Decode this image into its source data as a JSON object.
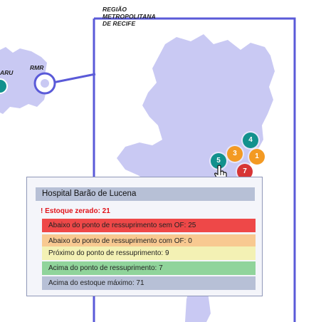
{
  "map": {
    "region_title_lines": [
      "REGIÃO",
      "METROPOLITANA",
      "DE RECIFE"
    ],
    "inset_label": "RMR",
    "left_region_label": "ARU",
    "colors": {
      "land": "#c9c9f3",
      "outline": "#5a5ad8",
      "teal": "#12918d",
      "orange": "#f39a23",
      "red": "#d73535"
    }
  },
  "markers": [
    {
      "name": "marker-teal-4",
      "value": "4",
      "color": "#12918d"
    },
    {
      "name": "marker-orange-3",
      "value": "3",
      "color": "#f39a23"
    },
    {
      "name": "marker-orange-1",
      "value": "1",
      "color": "#f39a23"
    },
    {
      "name": "marker-teal-5",
      "value": "5",
      "color": "#12918d"
    },
    {
      "name": "marker-red-7",
      "value": "7",
      "color": "#d73535"
    }
  ],
  "popup": {
    "title": "Hospital Barão de Lucena",
    "alert": "! Estoque zerado: 21",
    "rows": [
      {
        "label": "Abaixo do ponto de ressuprimento sem OF: 25",
        "color": "#ee4848"
      },
      {
        "label": "Abaixo do ponto de ressuprimento com OF: 0",
        "color": "#f8c991"
      },
      {
        "label": "Próximo do ponto de ressuprimento: 9",
        "color": "#f3f1b4"
      },
      {
        "label": "Acima do ponto de ressuprimento: 7",
        "color": "#90d49b"
      },
      {
        "label": "Acima do estoque máximo: 71",
        "color": "#b7c0d6"
      }
    ]
  }
}
